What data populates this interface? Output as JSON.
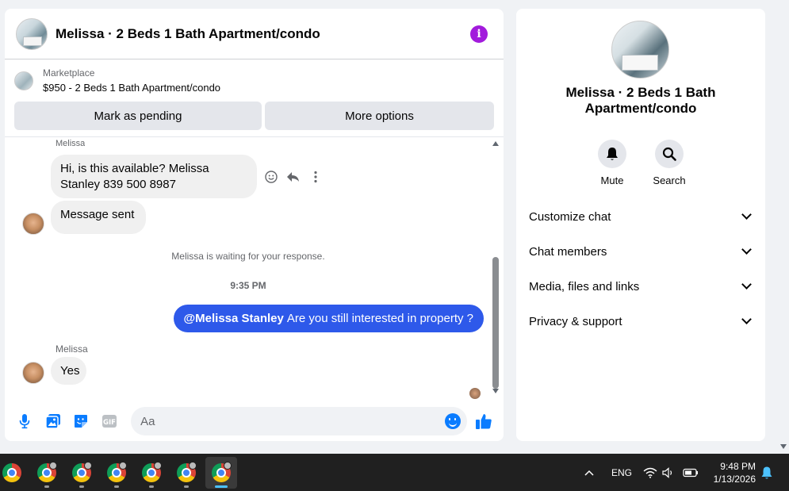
{
  "chat": {
    "title": "Melissa · 2 Beds 1 Bath Apartment/condo",
    "marketplace": {
      "label": "Marketplace",
      "listing": "$950 - 2 Beds 1 Bath Apartment/condo",
      "mark_pending": "Mark as pending",
      "more_options": "More options"
    },
    "messages": {
      "sender_top": "Melissa",
      "msg1": "Hi, is this available? Melissa Stanley 839 500 8987",
      "msg2": "Message sent",
      "status_note": "Melissa is waiting for your response.",
      "time": "9:35 PM",
      "my_mention": "@Melissa Stanley",
      "my_text": "Are you still interested in property ?",
      "sender_bottom": "Melissa",
      "msg3": "Yes"
    },
    "composer": {
      "placeholder": "Aa"
    }
  },
  "info": {
    "title": "Melissa · 2 Beds 1 Bath Apartment/condo",
    "actions": [
      {
        "label": "Mute",
        "icon": "bell-icon"
      },
      {
        "label": "Search",
        "icon": "search-icon"
      }
    ],
    "sections": [
      {
        "label": "Customize chat"
      },
      {
        "label": "Chat members"
      },
      {
        "label": "Media, files and links"
      },
      {
        "label": "Privacy & support"
      }
    ]
  },
  "taskbar": {
    "language": "ENG",
    "time": "9:48 PM",
    "date": "1/13/2026"
  },
  "colors": {
    "accent": "#2e59ea",
    "info_purple": "#a21bdc",
    "icon_blue": "#0a7cff"
  }
}
